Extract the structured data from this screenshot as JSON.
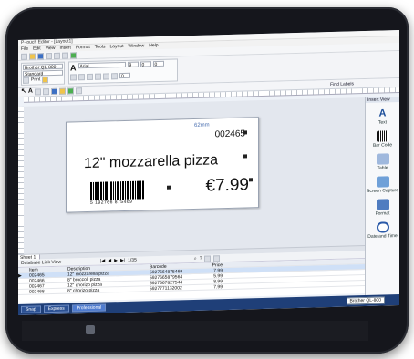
{
  "window": {
    "title": "P-touch Editor - [Layout1]"
  },
  "menu": [
    "File",
    "Edit",
    "View",
    "Insert",
    "Format",
    "Tools",
    "Layout",
    "Window",
    "Help"
  ],
  "properties": {
    "printer": "Brother QL-800",
    "paper": "Standard",
    "print_label": "Print",
    "font": "Arial",
    "font_size": "9",
    "value_a": "0",
    "value_b": "0",
    "value_c": "0"
  },
  "draw_toolbar": {
    "find_labels": "Find Labels"
  },
  "label": {
    "dimension": "62mm",
    "plu_code": "002465",
    "product": "12\" mozzarella pizza",
    "price": "€7.99",
    "barcode_digits": "5   192766 875469"
  },
  "side_panel": {
    "title": "Insert View",
    "items": [
      "Text",
      "Bar Code",
      "Table",
      "Screen Capture",
      "Format",
      "Date and Time"
    ]
  },
  "sheet_tab": "Sheet 1",
  "database": {
    "panel_label": "Database Link View",
    "record_count": "1/35",
    "columns": [
      "Item",
      "Description",
      "Barcode",
      "Price"
    ],
    "rows": [
      {
        "item": "002465",
        "description": "12\" mozzarella pizza",
        "barcode": "5927664875469",
        "price": "7.99"
      },
      {
        "item": "002466",
        "description": "8\" broccoli pizza",
        "barcode": "5927665879564",
        "price": "5.99"
      },
      {
        "item": "002467",
        "description": "12\" chorizo pizza",
        "barcode": "5927667827544",
        "price": "8.99"
      },
      {
        "item": "002468",
        "description": "8\" chorizo pizza",
        "barcode": "5927771132002",
        "price": "7.99"
      }
    ]
  },
  "status": {
    "modes": [
      "Snap",
      "Express",
      "Professional"
    ],
    "active_mode": "Professional",
    "printer": "Brother QL-800"
  }
}
